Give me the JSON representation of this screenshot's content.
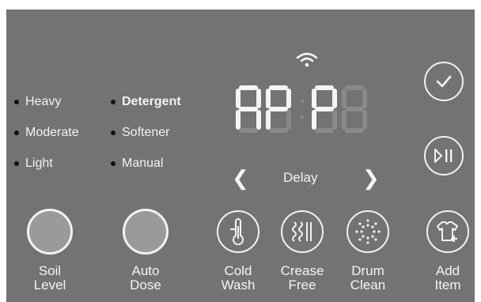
{
  "soil_options": [
    {
      "label": "Heavy"
    },
    {
      "label": "Moderate"
    },
    {
      "label": "Light"
    }
  ],
  "dose_options": [
    {
      "label": "Detergent",
      "selected": true
    },
    {
      "label": "Softener"
    },
    {
      "label": "Manual"
    }
  ],
  "display": {
    "text": "AP:P8",
    "lit": "AP:P"
  },
  "delay": {
    "label": "Delay"
  },
  "buttons": [
    {
      "line1": "Soil",
      "line2": "Level"
    },
    {
      "line1": "Auto",
      "line2": "Dose"
    },
    {
      "line1": "Cold",
      "line2": "Wash"
    },
    {
      "line1": "Crease",
      "line2": "Free"
    },
    {
      "line1": "Drum",
      "line2": "Clean"
    },
    {
      "line1": "Add",
      "line2": "Item"
    }
  ],
  "colors": {
    "panel": "#737373",
    "lit_text": "#f4f4f4",
    "dim_segment": "#898989"
  }
}
